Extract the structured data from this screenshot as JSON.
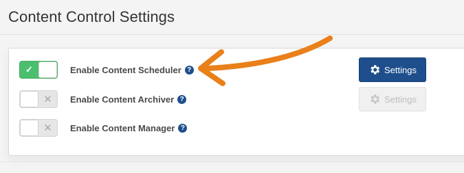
{
  "page": {
    "title": "Content Control Settings"
  },
  "settings": [
    {
      "label": "Enable Content Scheduler",
      "enabled": true,
      "help": "?"
    },
    {
      "label": "Enable Content Archiver",
      "enabled": false,
      "help": "?"
    },
    {
      "label": "Enable Content Manager",
      "enabled": false,
      "help": "?"
    }
  ],
  "toggle": {
    "on_glyph": "✓",
    "off_glyph": "✕"
  },
  "buttons": {
    "scheduler_settings": {
      "label": "Settings",
      "state": "active"
    },
    "archiver_settings": {
      "label": "Settings",
      "state": "disabled"
    }
  },
  "annotation": {
    "arrow_color": "#e9801a",
    "points_to": "Enable Content Scheduler"
  },
  "colors": {
    "toggle_on": "#4cbf6f",
    "primary_button": "#1e4f8c",
    "help_icon": "#1e4f8c"
  }
}
